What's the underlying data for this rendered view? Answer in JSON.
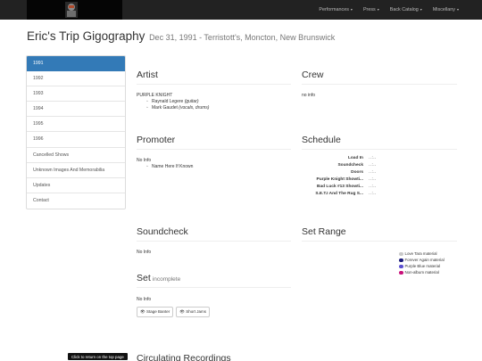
{
  "nav": {
    "items": [
      "Performances",
      "Press",
      "Back Catalog",
      "Miscellany"
    ]
  },
  "page": {
    "title": "Eric's Trip Gigography",
    "subtitle": "Dec 31, 1991 - Terristott's, Moncton, New Brunswick"
  },
  "sidebar": {
    "items": [
      "1991",
      "1992",
      "1993",
      "1994",
      "1995",
      "1996",
      "Cancelled Shows",
      "Unknown Images And Memorabilia",
      "Updates",
      "Contact"
    ],
    "active": "1991"
  },
  "artist": {
    "heading": "Artist",
    "band": "PURPLE KNIGHT",
    "members": [
      "Raynald Legere (guitar)",
      "Mark Gaudet (vocals, drums)"
    ]
  },
  "crew": {
    "heading": "Crew",
    "text": "no info"
  },
  "promoter": {
    "heading": "Promoter",
    "text": "No Info",
    "items": [
      "Name Here If Known"
    ]
  },
  "schedule": {
    "heading": "Schedule",
    "rows": [
      {
        "label": "Load In",
        "value": "..:.."
      },
      {
        "label": "Soundcheck",
        "value": "..:.."
      },
      {
        "label": "Doors",
        "value": "..:.."
      },
      {
        "label": "Purple Knight Showti...",
        "value": "..:.."
      },
      {
        "label": "Bad Luck #13 Showti...",
        "value": "..:.."
      },
      {
        "label": "S.E.T.I And The Rug S...",
        "value": "..:.."
      }
    ]
  },
  "soundcheck": {
    "heading": "Soundcheck",
    "text": "No Info"
  },
  "set_range": {
    "heading": "Set Range",
    "legend": [
      {
        "label": "Love Tara material",
        "color": "#c8c8c8"
      },
      {
        "label": "Forever Again material",
        "color": "#1a1a7a"
      },
      {
        "label": "Purple Blue material",
        "color": "#5b4fcf"
      },
      {
        "label": "Non-album material",
        "color": "#c8107a"
      }
    ]
  },
  "set": {
    "heading": "Set",
    "qualifier": "incomplete",
    "text": "No Info",
    "buttons": [
      "Stage Banter",
      "Short Jams"
    ]
  },
  "footer": {
    "tooltip": "Click to return on the top page",
    "next_heading": "Circulating Recordings"
  }
}
